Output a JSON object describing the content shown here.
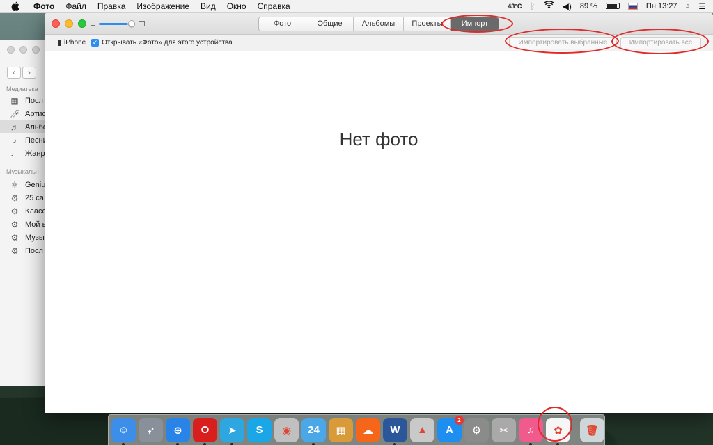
{
  "menubar": {
    "app_name": "Фото",
    "menus": [
      "Файл",
      "Правка",
      "Изображение",
      "Вид",
      "Окно",
      "Справка"
    ],
    "temperature": "43°C",
    "battery": "89 %",
    "clock": "Пн 13:27"
  },
  "itunes": {
    "section_library": "Медиатека",
    "library_items": [
      {
        "label": "Посл",
        "icon": "grid-icon"
      },
      {
        "label": "Артис",
        "icon": "microphone-icon"
      },
      {
        "label": "Альбо",
        "icon": "album-icon"
      },
      {
        "label": "Песни",
        "icon": "note-icon"
      },
      {
        "label": "Жанр",
        "icon": "genre-icon"
      }
    ],
    "section_playlists": "Музыкальн",
    "playlist_items": [
      {
        "label": "Geniu",
        "icon": "atom-icon"
      },
      {
        "label": "25 са",
        "icon": "gear-icon"
      },
      {
        "label": "Класс",
        "icon": "gear-icon"
      },
      {
        "label": "Мой в",
        "icon": "gear-icon"
      },
      {
        "label": "Музы",
        "icon": "gear-icon"
      },
      {
        "label": "Посл",
        "icon": "gear-icon"
      }
    ]
  },
  "photos": {
    "tabs": [
      {
        "label": "Фото",
        "active": false
      },
      {
        "label": "Общие",
        "active": false
      },
      {
        "label": "Альбомы",
        "active": false
      },
      {
        "label": "Проекты",
        "active": false
      },
      {
        "label": "Импорт",
        "active": true
      }
    ],
    "device_name": "iPhone",
    "open_photos_checkbox_label": "Открывать «Фото» для этого устройства",
    "open_photos_checked": true,
    "import_selected_label": "Импортировать выбранные",
    "import_all_label": "Импортировать все",
    "empty_message": "Нет фото"
  },
  "dock": {
    "items": [
      {
        "name": "finder-icon",
        "color": "#3c8ee8",
        "glyph": "☺",
        "running": true
      },
      {
        "name": "launchpad-icon",
        "color": "#8a9099",
        "glyph": "➶",
        "running": false
      },
      {
        "name": "safari-icon",
        "color": "#2a84e8",
        "glyph": "⊕",
        "running": true
      },
      {
        "name": "opera-icon",
        "color": "#d91e1e",
        "glyph": "O",
        "running": true
      },
      {
        "name": "telegram-icon",
        "color": "#2ea6df",
        "glyph": "➤",
        "running": true
      },
      {
        "name": "skype-icon",
        "color": "#1ba6e8",
        "glyph": "S",
        "running": false
      },
      {
        "name": "screenshot-app-icon",
        "color": "#c0c0c0",
        "glyph": "◉",
        "running": false
      },
      {
        "name": "calendar-24-icon",
        "color": "#4aa8e8",
        "glyph": "24",
        "running": true
      },
      {
        "name": "preview-icon",
        "color": "#d99a3a",
        "glyph": "▦",
        "running": false
      },
      {
        "name": "soundcloud-icon",
        "color": "#f5661a",
        "glyph": "☁",
        "running": false
      },
      {
        "name": "word-icon",
        "color": "#2b579a",
        "glyph": "W",
        "running": true
      },
      {
        "name": "vlc-icon",
        "color": "#c9c9c9",
        "glyph": "▲",
        "running": false
      },
      {
        "name": "app-store-icon",
        "color": "#1e8ef0",
        "glyph": "A",
        "running": false,
        "badge": "2"
      },
      {
        "name": "system-preferences-icon",
        "color": "#8b8b8b",
        "glyph": "⚙",
        "running": false
      },
      {
        "name": "utility-app-icon",
        "color": "#a9a9a9",
        "glyph": "✂",
        "running": false
      },
      {
        "name": "itunes-icon",
        "color": "#f05a8c",
        "glyph": "♫",
        "running": true
      },
      {
        "name": "photos-app-icon",
        "color": "#f6f6f6",
        "glyph": "✿",
        "running": true
      }
    ],
    "trash": {
      "name": "trash-icon",
      "color": "#cfd6da",
      "glyph": "🗑"
    }
  },
  "colors": {
    "annotation_red": "#e12a2a",
    "accent_blue": "#2c8cf0",
    "active_tab": "#6a6a6a"
  }
}
